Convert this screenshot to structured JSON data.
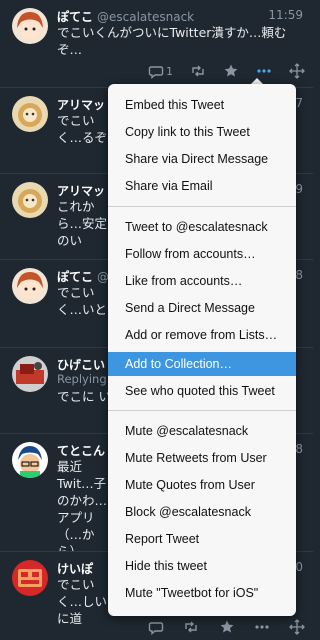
{
  "colors": {
    "background": "#1f2730",
    "accent": "#4aa6ea",
    "menu_highlight": "#3e96e0"
  },
  "tweets": [
    {
      "name": "ぽてこ",
      "handle": "@escalatesnack",
      "time": "11:59",
      "body": "でこいくんがついにTwitter潰すか…頼むぞ…",
      "reply_count": "1"
    },
    {
      "name": "アリマッ",
      "time": "7",
      "body": "でこいく…るぞ"
    },
    {
      "name": "アリマッ",
      "time": "9",
      "body": "これから…安定のい"
    },
    {
      "name": "ぽてこ",
      "handle": "@",
      "time": "8",
      "body": "でこいく…いと"
    },
    {
      "name": "ひげこい",
      "sub": "Replying",
      "body": "でこに い"
    },
    {
      "name": "てとこん",
      "time": "8",
      "body": "最近Twit…子のかわ…アプリ（…から）"
    },
    {
      "name": "けいぽ",
      "time": "0",
      "body": "でこいく…しいに道"
    }
  ],
  "menu": {
    "groups": [
      [
        "Embed this Tweet",
        "Copy link to this Tweet",
        "Share via Direct Message",
        "Share via Email"
      ],
      [
        "Tweet to @escalatesnack",
        "Follow from accounts…",
        "Like from accounts…",
        "Send a Direct Message",
        "Add or remove from Lists…",
        "Add to Collection…",
        "See who quoted this Tweet"
      ],
      [
        "Mute @escalatesnack",
        "Mute Retweets from User",
        "Mute Quotes from User",
        "Block @escalatesnack",
        "Report Tweet",
        "Hide this tweet",
        "Mute \"Tweetbot for iOS\""
      ]
    ],
    "highlighted": "Add to Collection…"
  }
}
